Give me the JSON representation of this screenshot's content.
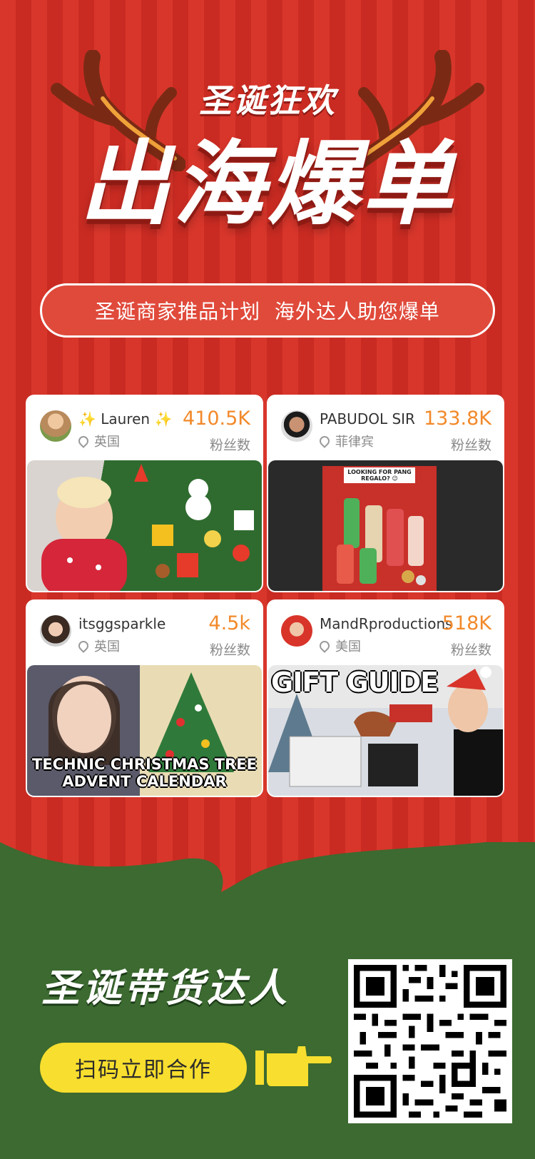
{
  "colors": {
    "red": "#d8362b",
    "dark_red": "#c92b22",
    "green": "#3c6a30",
    "orange_count": "#f2892a",
    "cta_yellow": "#f8de2e"
  },
  "header": {
    "top_title": "圣诞狂欢",
    "hero_title": "出海爆单",
    "pill_text": "圣诞商家推品计划  海外达人助您爆单"
  },
  "cards": [
    {
      "name": "✨ Lauren ✨",
      "location": "英国",
      "count": "410.5K",
      "count_label": "粉丝数"
    },
    {
      "name": "PABUDOL SIR",
      "location": "菲律宾",
      "count": "133.8K",
      "count_label": "粉丝数",
      "media_caption": "LOOKING FOR PANG REGALO? 😉"
    },
    {
      "name": "itsggsparkle",
      "location": "英国",
      "count": "4.5k",
      "count_label": "粉丝数",
      "media_caption": "TECHNIC CHRISTMAS TREE ADVENT CALENDAR"
    },
    {
      "name": "MandRproductions",
      "location": "美国",
      "count": "518K",
      "count_label": "粉丝数",
      "media_caption": "GIFT GUIDE"
    }
  ],
  "footer": {
    "title": "圣诞带货达人",
    "cta_label": "扫码立即合作",
    "qr_icon": "qr-code-icon",
    "hand_icon": "pointing-hand-icon"
  }
}
